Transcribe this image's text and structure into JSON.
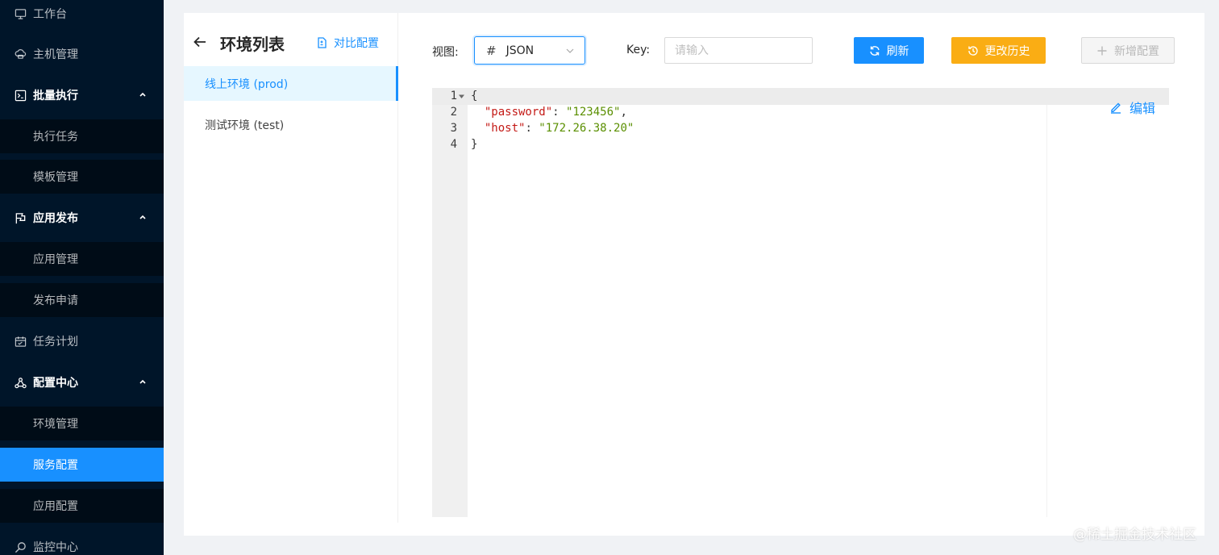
{
  "sidebar": {
    "items": [
      {
        "label": "工作台",
        "icon": "desktop-icon"
      },
      {
        "label": "主机管理",
        "icon": "cloud-server-icon"
      },
      {
        "label": "批量执行",
        "icon": "terminal-icon",
        "expanded": true
      },
      {
        "label": "执行任务"
      },
      {
        "label": "模板管理"
      },
      {
        "label": "应用发布",
        "icon": "flag-icon",
        "expanded": true
      },
      {
        "label": "应用管理"
      },
      {
        "label": "发布申请"
      },
      {
        "label": "任务计划",
        "icon": "schedule-icon"
      },
      {
        "label": "配置中心",
        "icon": "cluster-icon",
        "expanded": true
      },
      {
        "label": "环境管理"
      },
      {
        "label": "服务配置",
        "selected": true
      },
      {
        "label": "应用配置"
      },
      {
        "label": "监控中心",
        "icon": "monitor-icon"
      }
    ]
  },
  "env_panel": {
    "title": "环境列表",
    "compare_label": "对比配置",
    "items": [
      {
        "label": "线上环境 (prod)",
        "active": true
      },
      {
        "label": "测试环境 (test)"
      }
    ]
  },
  "toolbar": {
    "view_label": "视图:",
    "view_selected": "JSON",
    "key_label": "Key:",
    "key_placeholder": "请输入",
    "refresh_label": "刷新",
    "history_label": "更改历史",
    "add_label": "新增配置"
  },
  "editor": {
    "line_numbers": [
      "1",
      "2",
      "3",
      "4"
    ],
    "lines": [
      {
        "open": "{"
      },
      {
        "indent": "  ",
        "key": "\"password\"",
        "sep": ": ",
        "value": "\"123456\"",
        "trail": ","
      },
      {
        "indent": "  ",
        "key": "\"host\"",
        "sep": ": ",
        "value": "\"172.26.38.20\"",
        "trail": ""
      },
      {
        "open": "}"
      }
    ],
    "edit_label": "编辑"
  },
  "watermark": "@稀土掘金技术社区",
  "colors": {
    "sidebar_bg": "#001529",
    "primary": "#1890ff",
    "warning": "#faad14",
    "json_key": "#c41a16",
    "json_string": "#5a8f00"
  }
}
